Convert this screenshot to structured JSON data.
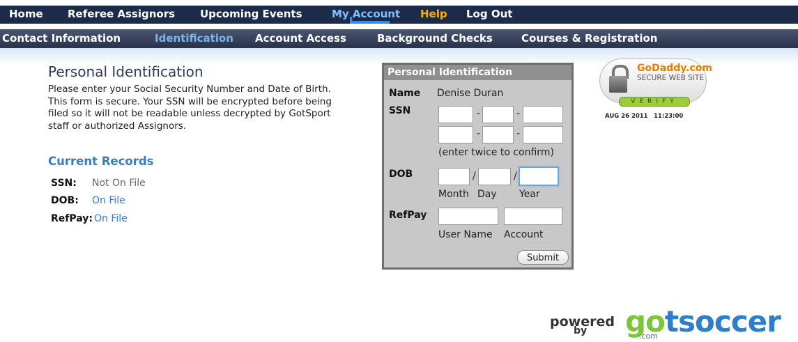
{
  "topnav": {
    "items": [
      "Home",
      "Referee Assignors",
      "Upcoming Events",
      "My Account",
      "Help",
      "Log Out"
    ],
    "active": "My Account"
  },
  "subnav": {
    "items": [
      "Contact Information",
      "Identification",
      "Account Access",
      "Background Checks",
      "Courses & Registration"
    ],
    "active": "Identification"
  },
  "main": {
    "title": "Personal Identification",
    "intro": "Please enter your Social Security Number and Date of Birth. This form is secure. Your SSN will be encrypted before being filed so it will not be readable unless decrypted by GotSport staff or authorized Assignors.",
    "records_title": "Current Records",
    "records": [
      {
        "label": "SSN:",
        "value": "Not On File",
        "is_link": false
      },
      {
        "label": "DOB:",
        "value": "On File",
        "is_link": true
      },
      {
        "label": "RefPay:",
        "value": "On File",
        "is_link": true
      }
    ]
  },
  "form": {
    "header": "Personal Identification",
    "name_label": "Name",
    "name_value": "Denise Duran",
    "ssn_label": "SSN",
    "ssn_sep": "-",
    "ssn_hint": "(enter twice to confirm)",
    "dob_label": "DOB",
    "dob_sep": "/",
    "dob_month": "Month",
    "dob_day": "Day",
    "dob_year": "Year",
    "refpay_label": "RefPay",
    "refpay_user": "User Name",
    "refpay_account": "Account",
    "submit": "Submit"
  },
  "seal": {
    "brand": "GoDaddy.com",
    "text": "SECURE WEB SITE",
    "verify": "VERIFY",
    "date": "AUG 26 2011",
    "time": "11:23:00"
  },
  "footer": {
    "powered": "powered",
    "by": "by",
    "logo_first": "go",
    "logo_rest": "tsoccer",
    "com": ".com"
  },
  "colors": {
    "nav_bg": "#1c2b4a",
    "active_link": "#7ec0ff",
    "help": "#ffb000",
    "link": "#2f7bd4",
    "heading": "#3b7cb8"
  }
}
